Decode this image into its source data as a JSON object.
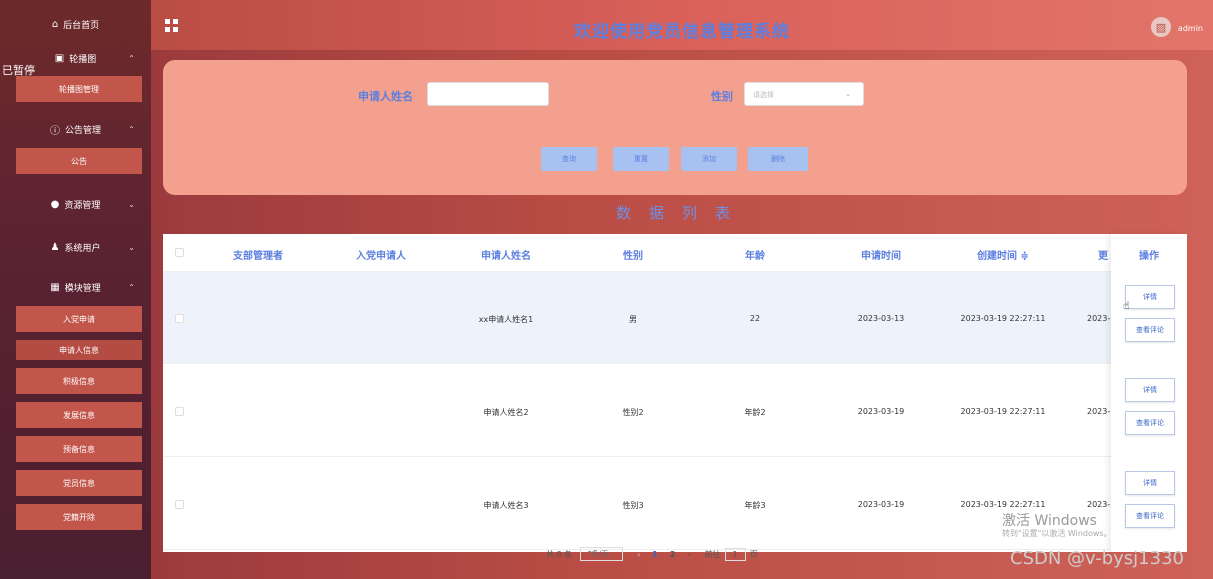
{
  "sidebar": {
    "home": "后台首页",
    "paused": "已暂停",
    "carousel_group": "轮播图",
    "carousel_mgmt": "轮播图管理",
    "notice_group": "公告管理",
    "notice": "公告",
    "resource_group": "资源管理",
    "users_group": "系统用户",
    "module_group": "模块管理",
    "module_items": [
      "入党申请",
      "申请人信息",
      "积极信息",
      "发展信息",
      "预备信息",
      "党员信息",
      "党籍开除"
    ]
  },
  "header": {
    "title": "欢迎使用党员信息管理系统",
    "user": "admin"
  },
  "search": {
    "name_label": "申请人姓名",
    "gender_label": "性别",
    "gender_placeholder": "请选择",
    "buttons": [
      "查询",
      "重置",
      "添加",
      "删除"
    ]
  },
  "list_title": "数据列表",
  "table": {
    "columns": [
      "支部管理者",
      "入党申请人",
      "申请人姓名",
      "性别",
      "年龄",
      "申请时间",
      "创建时间 ≑",
      "更",
      "操作"
    ],
    "rows": [
      {
        "name": "xx申请人姓名1",
        "gender": "男",
        "age": "22",
        "apply": "2023-03-13",
        "created": "2023-03-19 22:27:11",
        "updated": "2023-"
      },
      {
        "name": "申请人姓名2",
        "gender": "性别2",
        "age": "年龄2",
        "apply": "2023-03-19",
        "created": "2023-03-19 22:27:11",
        "updated": "2023-"
      },
      {
        "name": "申请人姓名3",
        "gender": "性别3",
        "age": "年龄3",
        "apply": "2023-03-19",
        "created": "2023-03-19 22:27:11",
        "updated": "2023-"
      }
    ],
    "op_detail": "详情",
    "op_comment": "查看评论"
  },
  "pager": {
    "total": "共 8 条",
    "size": "7条/页",
    "pages": [
      "1",
      "2"
    ],
    "goto": "前往",
    "goto_value": "1",
    "page_unit": "页"
  },
  "watermark": {
    "activate": "激活 Windows",
    "activate_hint": "转到\"设置\"以激活 Windows。",
    "csdn": "CSDN @v-bysj1330"
  }
}
